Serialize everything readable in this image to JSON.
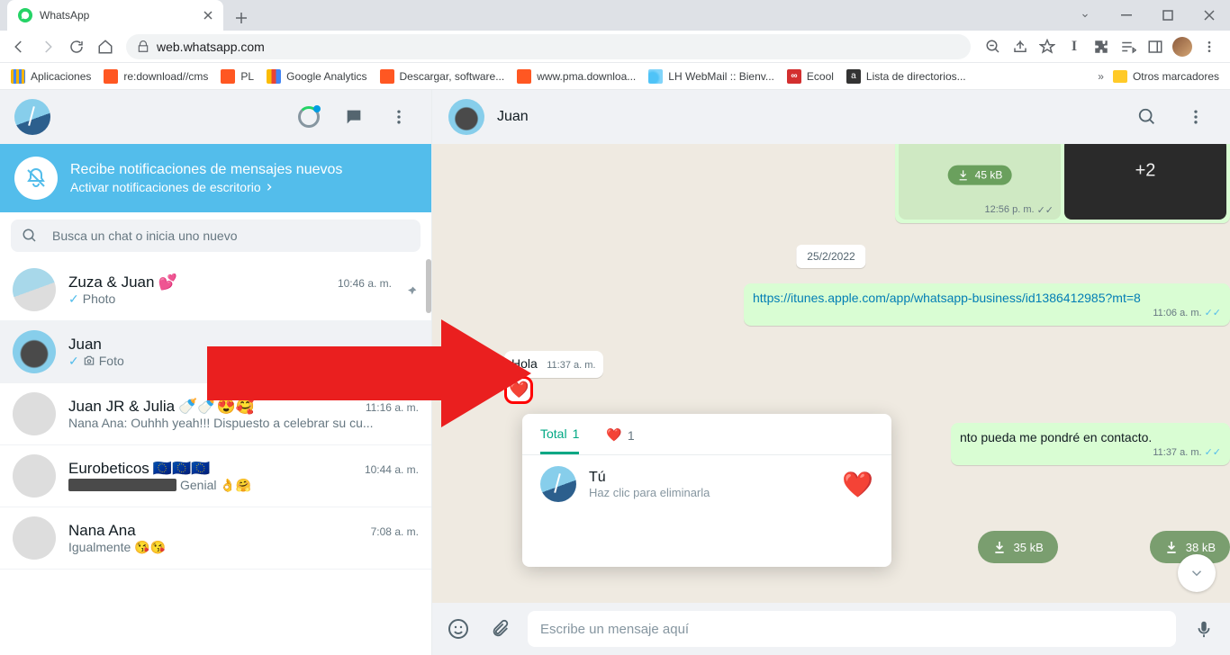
{
  "browser": {
    "tab_title": "WhatsApp",
    "url": "web.whatsapp.com",
    "bookmarks": {
      "apps": "Aplicaciones",
      "re": "re:download//cms",
      "pl": "PL",
      "ga": "Google Analytics",
      "desc": "Descargar, software...",
      "pma": "www.pma.downloa...",
      "lh": "LH WebMail :: Bienv...",
      "ecool": "Ecool",
      "dir": "Lista de directorios...",
      "other": "Otros marcadores"
    }
  },
  "notif": {
    "title": "Recibe notificaciones de mensajes nuevos",
    "sub": "Activar notificaciones de escritorio"
  },
  "search": {
    "placeholder": "Busca un chat o inicia uno nuevo"
  },
  "chats": {
    "c0": {
      "name": "Zuza & Juan",
      "emoji": "💕",
      "time": "10:46 a. m.",
      "sub": "Photo"
    },
    "c1": {
      "name": "Juan",
      "time": "",
      "sub": "Foto"
    },
    "c2": {
      "name": "Juan JR & Julia",
      "emoji": "🍼🍼😍🥰",
      "time": "11:16 a. m.",
      "sub": "Nana Ana: Ouhhh yeah!!! Dispuesto a celebrar su cu..."
    },
    "c3": {
      "name": "Eurobeticos",
      "emoji": "🇪🇺🇪🇺🇪🇺",
      "time": "10:44 a. m.",
      "sub_after": " Genial 👌🤗"
    },
    "c4": {
      "name": "Nana Ana",
      "time": "7:08 a. m.",
      "sub": "Igualmente 😘😘"
    }
  },
  "conv": {
    "title": "Juan",
    "media_top": {
      "size": "45 kB",
      "plus": "+2",
      "time": "12:56 p. m."
    },
    "date": "25/2/2022",
    "link": {
      "url": "https://itunes.apple.com/app/whatsapp-business/id1386412985?mt=8",
      "time": "11:06 a. m."
    },
    "hola": {
      "text": "Hola",
      "time": "11:37 a. m."
    },
    "response": {
      "text": "nto pueda me pondré en contacto.",
      "time": "11:37 a. m."
    },
    "media_bottom": {
      "left": "35 kB",
      "right": "38 kB"
    }
  },
  "reactions": {
    "total_label": "Total",
    "total_count": "1",
    "emoji_count": "1",
    "who": "Tú",
    "hint": "Haz clic para eliminarla"
  },
  "composer": {
    "placeholder": "Escribe un mensaje aquí"
  }
}
